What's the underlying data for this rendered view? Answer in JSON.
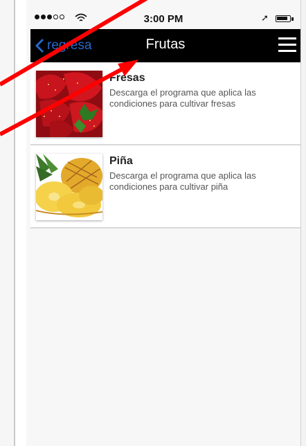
{
  "status_bar": {
    "time": "3:00 PM",
    "location_glyph": "➚"
  },
  "navbar": {
    "back_label": "regresa",
    "title": "Frutas"
  },
  "items": [
    {
      "title": "Fresas",
      "description": "Descarga el programa que aplica las condiciones para cultivar fresas",
      "image": "strawberry-image"
    },
    {
      "title": "Piña",
      "description": "Descarga el programa que aplica las condiciones para cultivar piña",
      "image": "pineapple-image"
    }
  ],
  "colors": {
    "navbar_bg": "#000000",
    "back_link": "#2a66c9",
    "annotation_arrow": "#ff0000"
  }
}
